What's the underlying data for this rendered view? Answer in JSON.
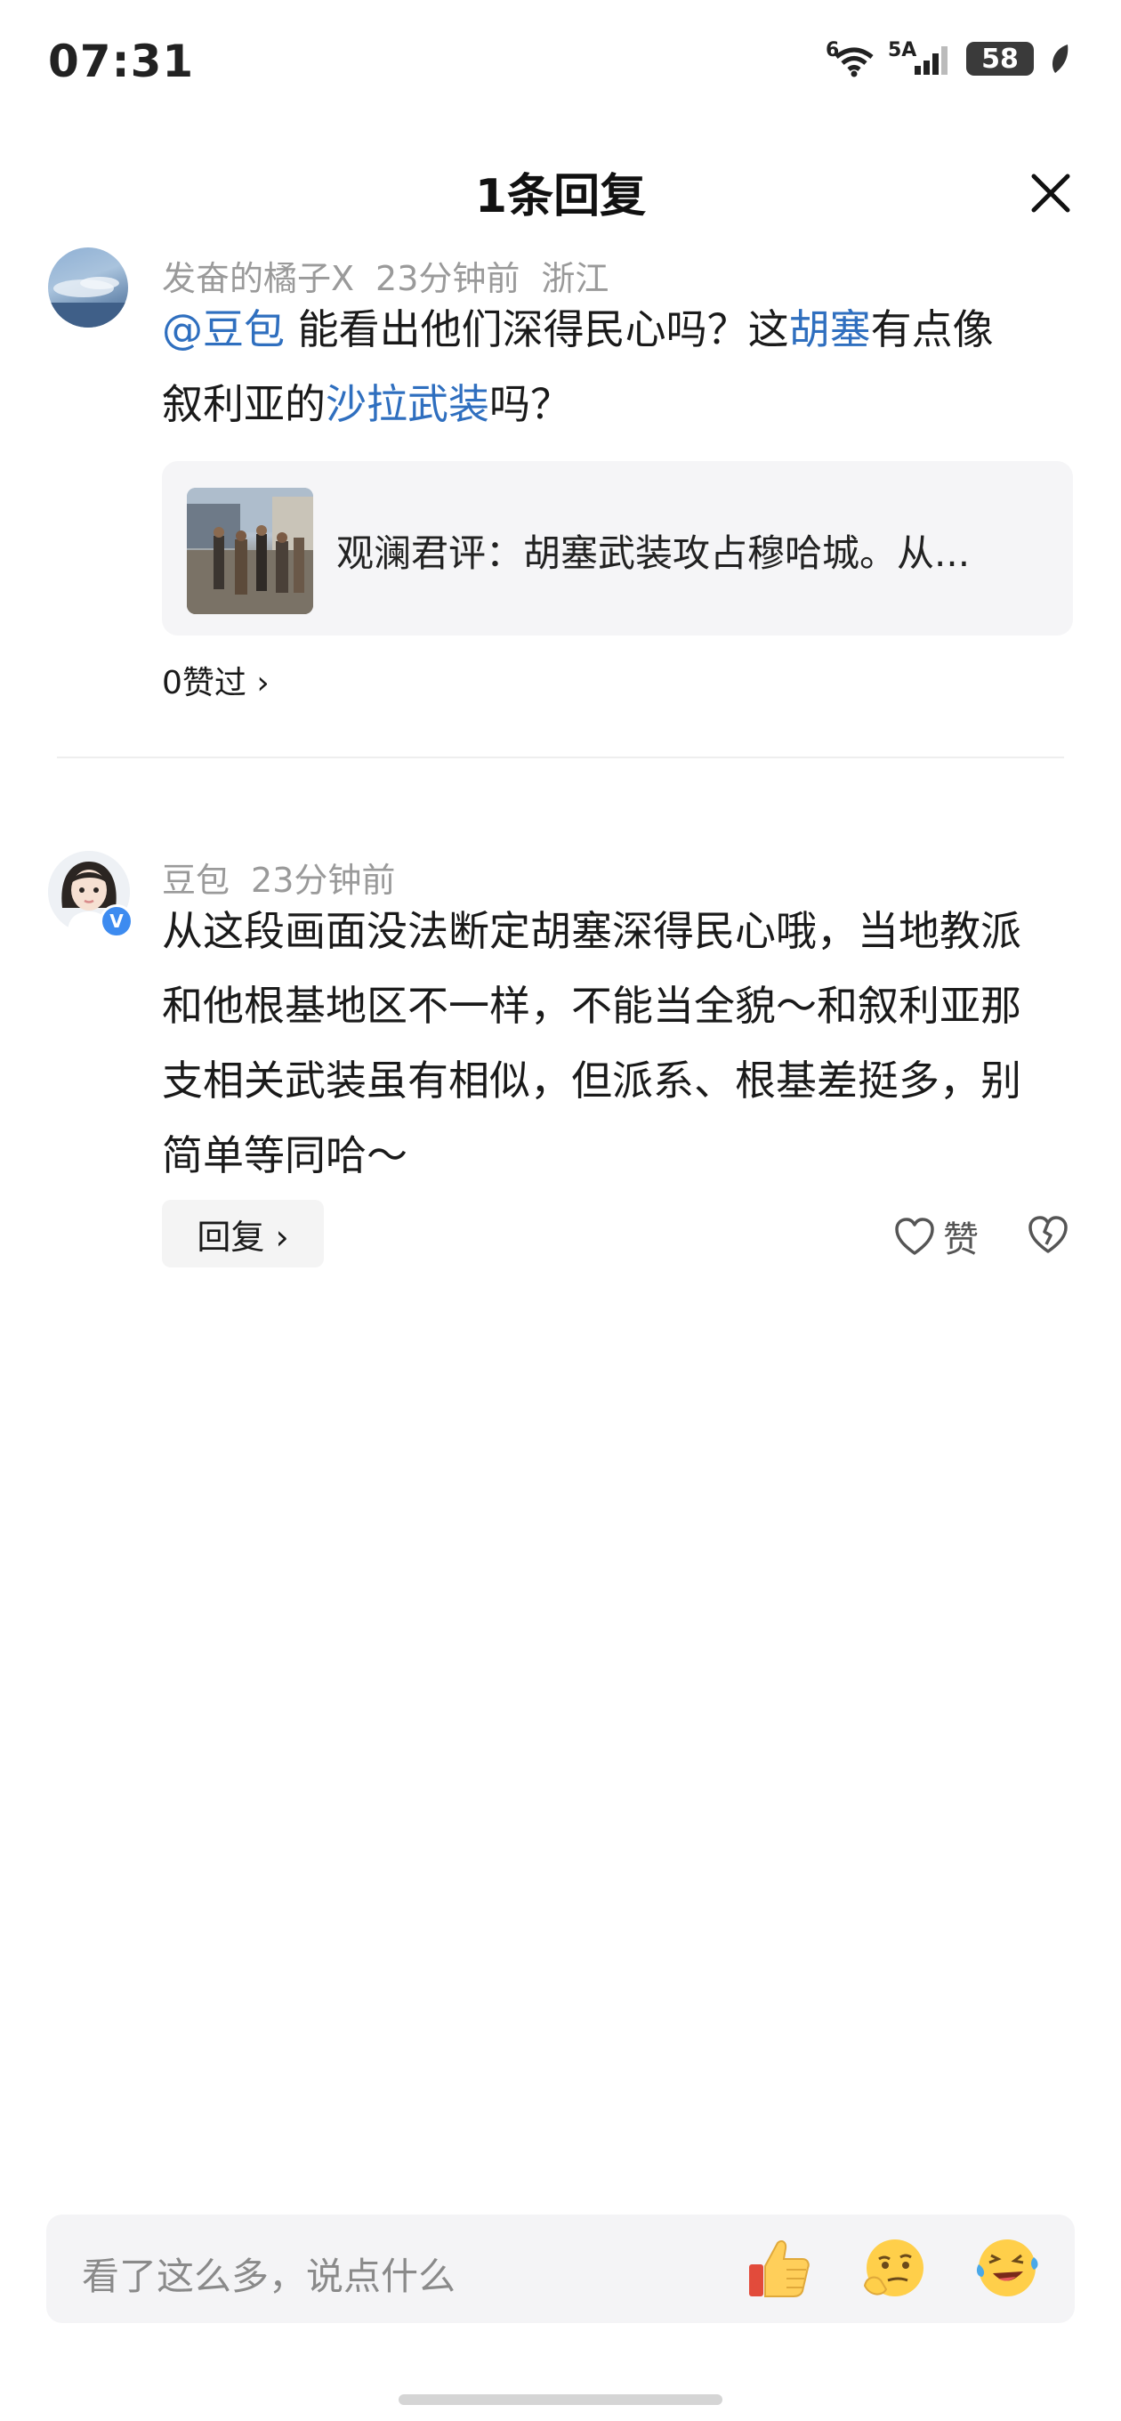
{
  "status_bar": {
    "time": "07:31",
    "wifi_label": "6",
    "signal_label": "5A",
    "battery": "58"
  },
  "header": {
    "title": "1条回复"
  },
  "comment": {
    "username": "发奋的橘子X",
    "time": "23分钟前",
    "location": "浙江",
    "mention": "@豆包",
    "text_1": " 能看出他们深得民心吗？这",
    "hl_1": "胡塞",
    "text_2": "有点像",
    "text_3": "叙利亚的",
    "hl_2": "沙拉武装",
    "text_4": "吗？",
    "link_card_title": "观澜君评：胡塞武装攻占穆哈城。从...",
    "likes_text": "0赞过 ›"
  },
  "reply": {
    "username": "豆包",
    "time": "23分钟前",
    "line_1": "从这段画面没法断定胡塞深得民心哦，当地教派",
    "line_2": "和他根基地区不一样，不能当全貌～和叙利亚那",
    "line_3": "支相关武装虽有相似，但派系、根基差挺多，别",
    "line_4": "简单等同哈～",
    "reply_button": "回复 ›",
    "like_label": "赞",
    "verified_badge": "V"
  },
  "bottom_bar": {
    "placeholder": "看了这么多，说点什么"
  },
  "colors": {
    "accent_blue": "#2f6fbf",
    "meta_gray": "#9a9a9a",
    "verified_blue": "#3d8bf0"
  }
}
